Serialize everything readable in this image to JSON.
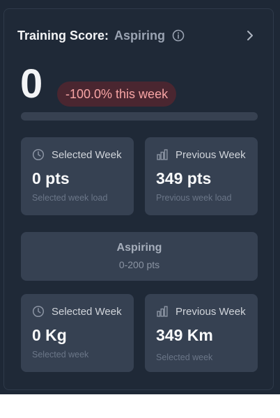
{
  "header": {
    "title_label": "Training Score:",
    "level": "Aspiring"
  },
  "score": {
    "value": "0",
    "change": "-100.0% this week",
    "progress_fraction": 0
  },
  "stats_points": [
    {
      "label": "Selected Week",
      "value": "0 pts",
      "sub": "Selected week load",
      "icon": "clock-icon"
    },
    {
      "label": "Previous Week",
      "value": "349 pts",
      "sub": "Previous week load",
      "icon": "bar-chart-icon"
    }
  ],
  "level_box": {
    "name": "Aspiring",
    "range": "0-200 pts"
  },
  "stats_units": [
    {
      "label": "Selected Week",
      "value": "0 Kg",
      "sub": "Selected week",
      "icon": "clock-icon"
    },
    {
      "label": "Previous Week",
      "value": "349 Km",
      "sub": "Selected week",
      "icon": "bar-chart-icon"
    }
  ],
  "colors": {
    "background": "#1f2937",
    "tile": "#364152",
    "badge_bg": "#4a2630",
    "badge_text": "#f8a5a5"
  }
}
